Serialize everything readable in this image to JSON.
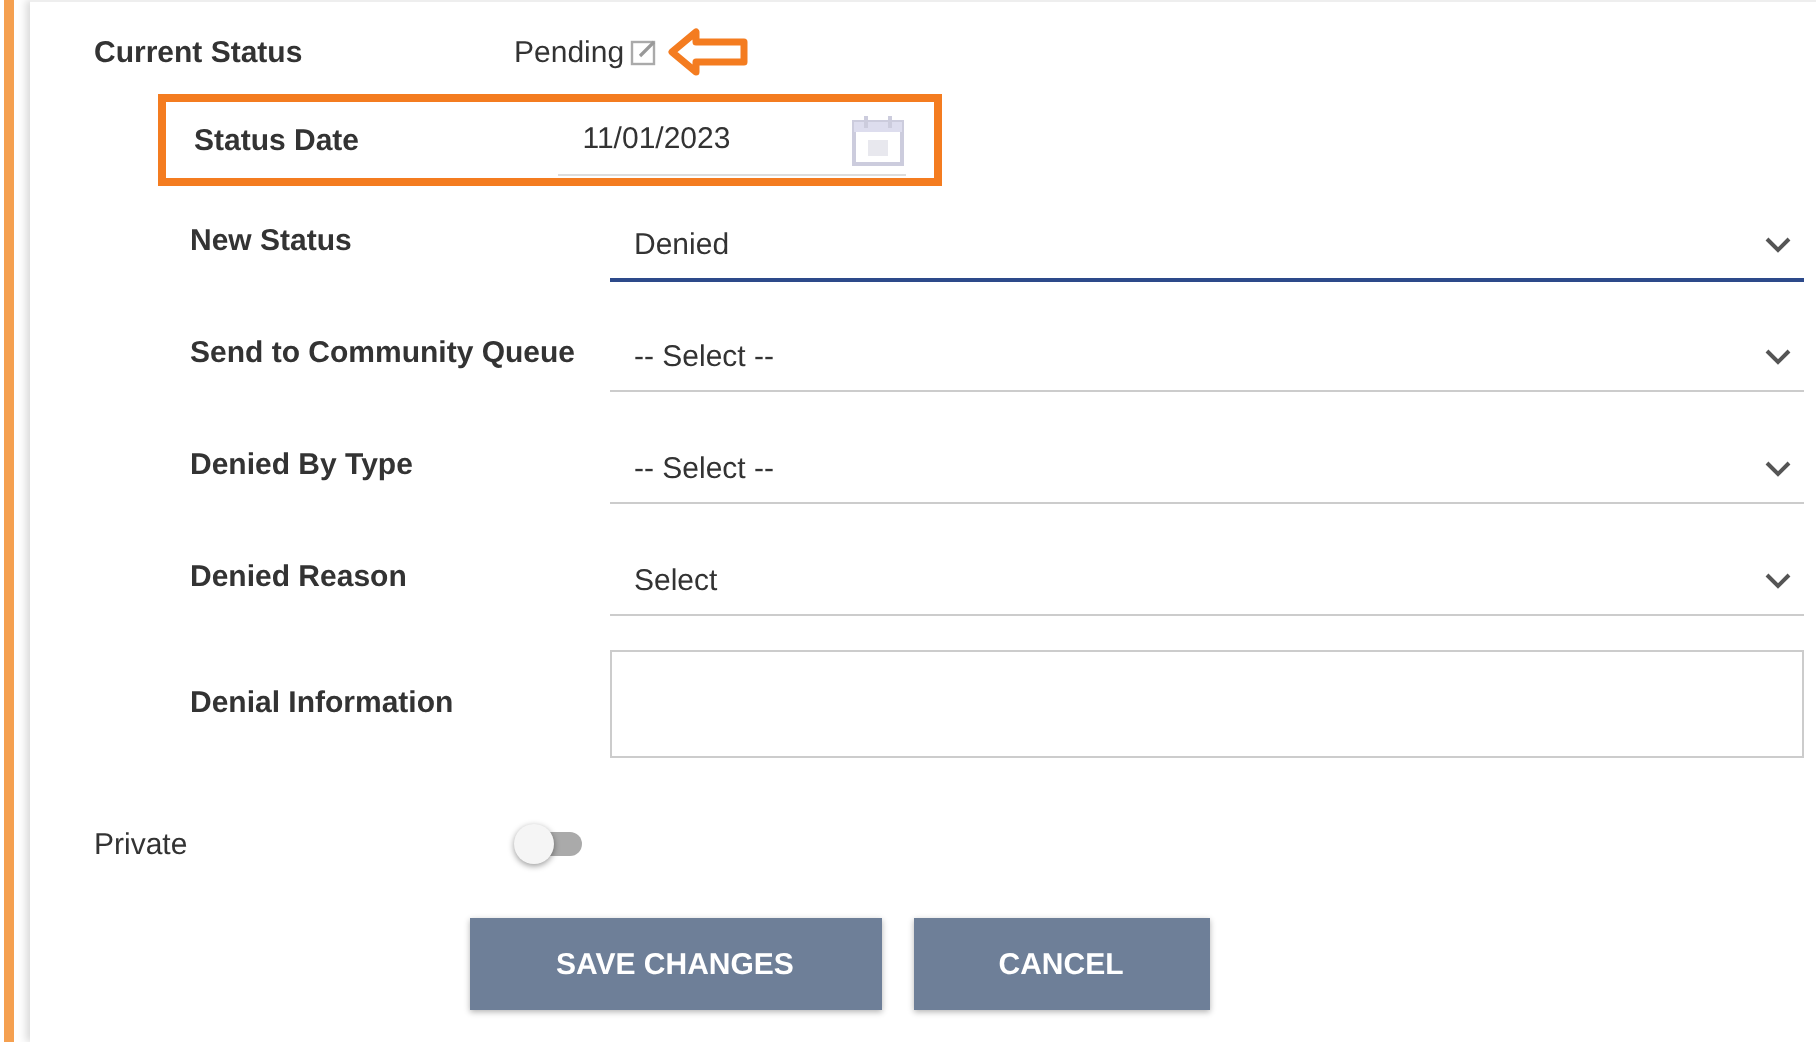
{
  "current_status": {
    "label": "Current Status",
    "value": "Pending"
  },
  "status_date": {
    "label": "Status Date",
    "value": "11/01/2023",
    "highlighted": true
  },
  "fields": [
    {
      "label": "New Status",
      "kind": "select",
      "value": "Denied",
      "focused": true
    },
    {
      "label": "Send to Community Queue",
      "kind": "select",
      "value": "-- Select --",
      "focused": false
    },
    {
      "label": "Denied By Type",
      "kind": "select",
      "value": "-- Select --",
      "focused": false
    },
    {
      "label": "Denied Reason",
      "kind": "select",
      "value": "Select",
      "focused": false
    },
    {
      "label": "Denial Information",
      "kind": "textarea",
      "focused": false
    }
  ],
  "private": {
    "label": "Private",
    "on": false
  },
  "buttons": [
    "SAVE CHANGES",
    "CANCEL"
  ]
}
